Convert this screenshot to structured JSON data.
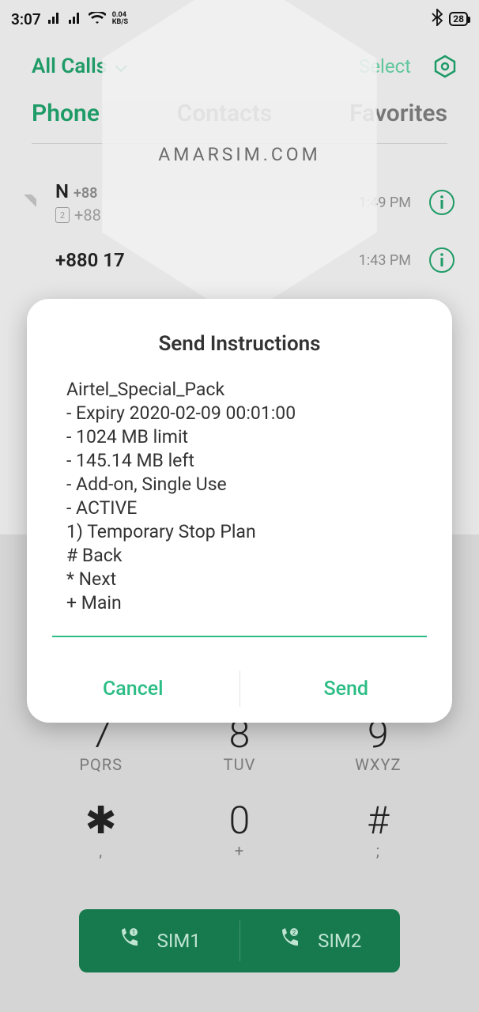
{
  "status": {
    "time": "3:07",
    "speed_top": "0.04",
    "speed_unit": "KB/S",
    "battery": "28"
  },
  "header": {
    "filter": "All Calls",
    "select": "Select"
  },
  "tabs": [
    "Phone",
    "Contacts",
    "Favorites"
  ],
  "watermark": "AMARSIM.COM",
  "calls": [
    {
      "primary": "N",
      "sub1": "+88",
      "sim": "2",
      "sub2": "+88",
      "time": "1:49 PM"
    },
    {
      "primary": "+880 17",
      "time": "1:43 PM"
    }
  ],
  "keypad": [
    {
      "num": "7",
      "lab": "PQRS"
    },
    {
      "num": "8",
      "lab": "TUV"
    },
    {
      "num": "9",
      "lab": "WXYZ"
    },
    {
      "num": "✱",
      "lab": ","
    },
    {
      "num": "0",
      "lab": "+"
    },
    {
      "num": "#",
      "lab": ";"
    }
  ],
  "sim": [
    "SIM1",
    "SIM2"
  ],
  "dialog": {
    "title": "Send Instructions",
    "lines": [
      "Airtel_Special_Pack",
      "- Expiry 2020-02-09 00:01:00",
      "- 1024 MB limit",
      "- 145.14 MB left",
      "- Add-on, Single Use",
      "- ACTIVE",
      "1) Temporary Stop Plan",
      "# Back",
      "* Next",
      "+ Main"
    ],
    "cancel": "Cancel",
    "send": "Send"
  }
}
